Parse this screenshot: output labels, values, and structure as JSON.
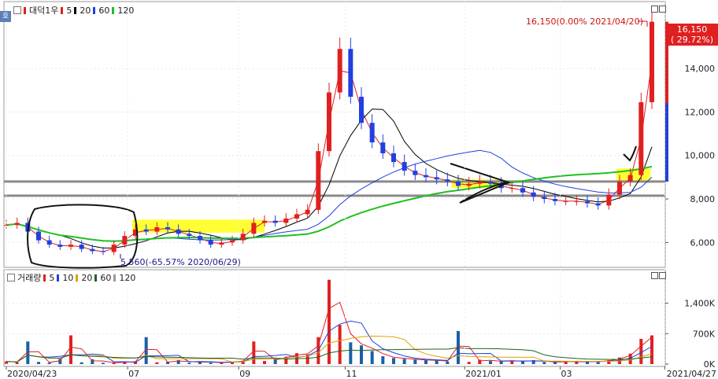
{
  "price_panel": {
    "legend": {
      "name": "대덕1우",
      "mas": [
        {
          "label": "5",
          "color": "#e02020"
        },
        {
          "label": "20",
          "color": "#000000"
        },
        {
          "label": "60",
          "color": "#2040e0"
        },
        {
          "label": "120",
          "color": "#20c020"
        }
      ]
    },
    "max_annotation": "16,150(0.00% 2021/04/20)",
    "min_annotation": "5,560(-65.57% 2020/06/29)",
    "current_price": "16,150",
    "current_change": "( 29.72%)"
  },
  "volume_panel": {
    "legend": {
      "name": "거래량",
      "mas": [
        {
          "label": "5",
          "color": "#e02020"
        },
        {
          "label": "10",
          "color": "#2040e0"
        },
        {
          "label": "20",
          "color": "#e0a000"
        },
        {
          "label": "60",
          "color": "#206020"
        },
        {
          "label": "120",
          "color": "#999999"
        }
      ]
    }
  },
  "side_icon_label": "호",
  "chart_data": [
    {
      "type": "candlestick",
      "title": "대덕1우",
      "y_ticks": [
        "6,000",
        "8,000",
        "10,000",
        "12,000",
        "14,000"
      ],
      "ylim": [
        5000,
        16500
      ],
      "x_tick_labels": [
        "2020/04/23",
        "07",
        "09",
        "11",
        "2021/01",
        "03",
        "2021/04/27"
      ],
      "horizontal_levels": [
        8800,
        8150
      ],
      "series_close": [
        6800,
        6900,
        6500,
        6100,
        5900,
        5800,
        5900,
        5700,
        5600,
        5560,
        5900,
        6300,
        6600,
        6500,
        6700,
        6600,
        6400,
        6300,
        6100,
        5900,
        6000,
        6100,
        6400,
        6900,
        7000,
        6900,
        7100,
        7300,
        7500,
        10200,
        12900,
        14900,
        12700,
        11500,
        10600,
        10100,
        9700,
        9300,
        9100,
        9000,
        8900,
        8800,
        8600,
        8700,
        8800,
        8700,
        8500,
        8500,
        8300,
        8100,
        8000,
        7900,
        7900,
        7900,
        7800,
        7700,
        8200,
        8800,
        9100,
        12450,
        16150
      ],
      "ma_lines": [
        "5",
        "20",
        "60",
        "120"
      ]
    },
    {
      "type": "bar",
      "title": "거래량",
      "y_ticks": [
        "0K",
        "700K",
        "1,400K"
      ],
      "ylim": [
        0,
        1900000
      ],
      "values": [
        60000,
        40000,
        520000,
        50000,
        30000,
        120000,
        660000,
        40000,
        110000,
        30000,
        30000,
        50000,
        60000,
        620000,
        40000,
        50000,
        90000,
        30000,
        60000,
        30000,
        40000,
        50000,
        80000,
        520000,
        70000,
        120000,
        170000,
        250000,
        220000,
        620000,
        1940000,
        900000,
        500000,
        430000,
        300000,
        180000,
        140000,
        120000,
        100000,
        90000,
        80000,
        60000,
        760000,
        50000,
        100000,
        70000,
        60000,
        80000,
        60000,
        90000,
        50000,
        40000,
        70000,
        60000,
        50000,
        60000,
        90000,
        150000,
        240000,
        580000,
        660000
      ]
    }
  ]
}
